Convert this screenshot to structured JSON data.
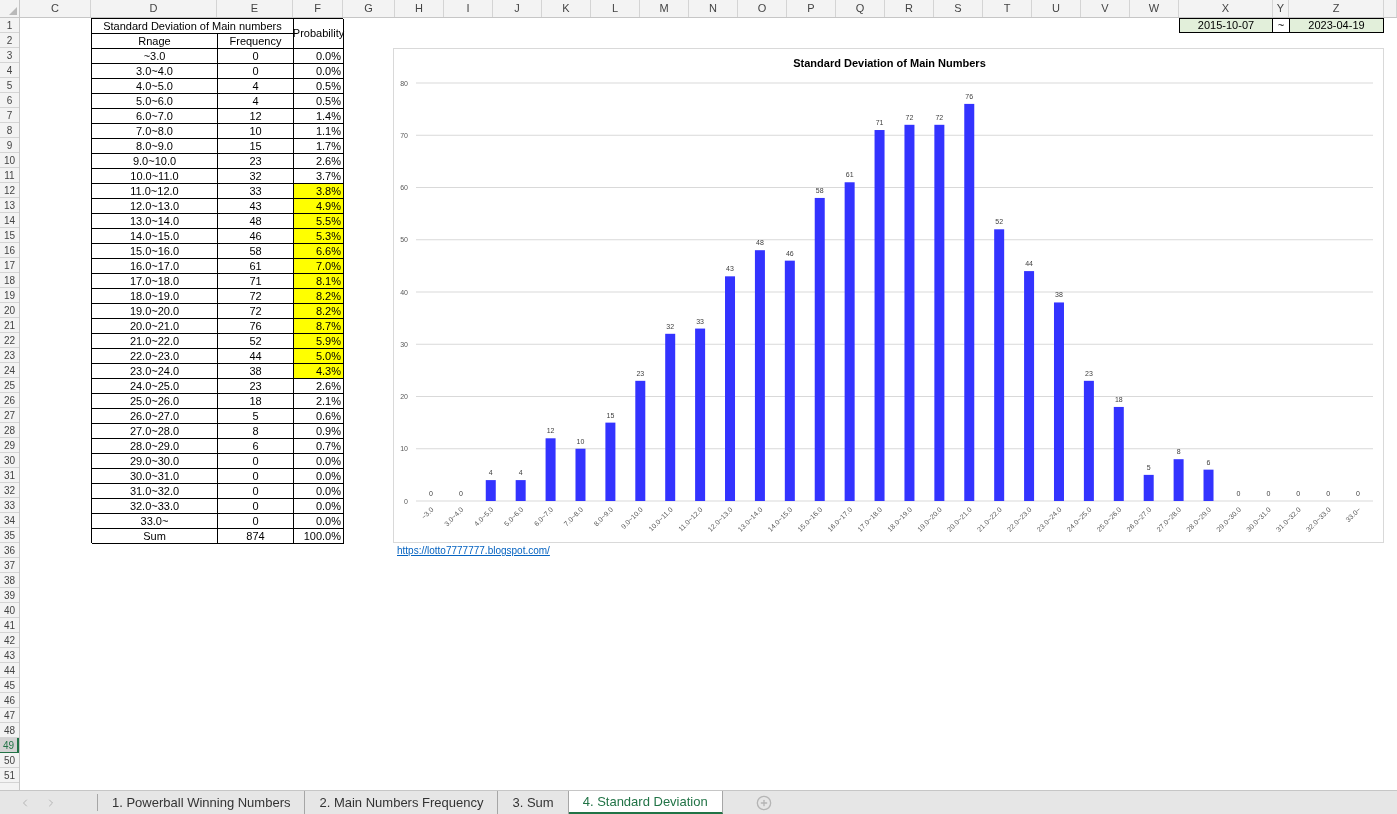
{
  "sheet": {
    "column_headers": [
      "C",
      "D",
      "E",
      "F",
      "G",
      "H",
      "I",
      "J",
      "K",
      "L",
      "M",
      "N",
      "O",
      "P",
      "Q",
      "R",
      "S",
      "T",
      "U",
      "V",
      "W",
      "X",
      "Y",
      "Z"
    ],
    "row_headers": [
      {
        "label": "1",
        "selected": false
      },
      {
        "label": "2",
        "selected": false
      },
      {
        "label": "3",
        "selected": false
      },
      {
        "label": "4",
        "selected": false
      },
      {
        "label": "5",
        "selected": false
      },
      {
        "label": "6",
        "selected": false
      },
      {
        "label": "7",
        "selected": false
      },
      {
        "label": "8",
        "selected": false
      },
      {
        "label": "9",
        "selected": false
      },
      {
        "label": "10",
        "selected": false
      },
      {
        "label": "11",
        "selected": false
      },
      {
        "label": "12",
        "selected": false
      },
      {
        "label": "13",
        "selected": false
      },
      {
        "label": "14",
        "selected": false
      },
      {
        "label": "15",
        "selected": false
      },
      {
        "label": "16",
        "selected": false
      },
      {
        "label": "17",
        "selected": false
      },
      {
        "label": "18",
        "selected": false
      },
      {
        "label": "19",
        "selected": false
      },
      {
        "label": "20",
        "selected": false
      },
      {
        "label": "21",
        "selected": false
      },
      {
        "label": "22",
        "selected": false
      },
      {
        "label": "23",
        "selected": false
      },
      {
        "label": "24",
        "selected": false
      },
      {
        "label": "25",
        "selected": false
      },
      {
        "label": "26",
        "selected": false
      },
      {
        "label": "27",
        "selected": false
      },
      {
        "label": "28",
        "selected": false
      },
      {
        "label": "29",
        "selected": false
      },
      {
        "label": "30",
        "selected": false
      },
      {
        "label": "31",
        "selected": false
      },
      {
        "label": "32",
        "selected": false
      },
      {
        "label": "33",
        "selected": false
      },
      {
        "label": "34",
        "selected": false
      },
      {
        "label": "35",
        "selected": false
      },
      {
        "label": "36",
        "selected": false
      },
      {
        "label": "37",
        "selected": false
      },
      {
        "label": "38",
        "selected": false
      },
      {
        "label": "39",
        "selected": false
      },
      {
        "label": "40",
        "selected": false
      },
      {
        "label": "41",
        "selected": false
      },
      {
        "label": "42",
        "selected": false
      },
      {
        "label": "43",
        "selected": false
      },
      {
        "label": "44",
        "selected": false
      },
      {
        "label": "45",
        "selected": false
      },
      {
        "label": "46",
        "selected": false
      },
      {
        "label": "47",
        "selected": false
      },
      {
        "label": "48",
        "selected": false
      },
      {
        "label": "49",
        "selected": true
      },
      {
        "label": "50",
        "selected": false
      },
      {
        "label": "51",
        "selected": false
      }
    ]
  },
  "table": {
    "title": "Standard Deviation of Main numbers",
    "columns": [
      "Rnage",
      "Frequency",
      "Probability"
    ],
    "rows": [
      {
        "range": "~3.0",
        "frequency": "0",
        "probability": "0.0%",
        "highlighted": false
      },
      {
        "range": "3.0~4.0",
        "frequency": "0",
        "probability": "0.0%",
        "highlighted": false
      },
      {
        "range": "4.0~5.0",
        "frequency": "4",
        "probability": "0.5%",
        "highlighted": false
      },
      {
        "range": "5.0~6.0",
        "frequency": "4",
        "probability": "0.5%",
        "highlighted": false
      },
      {
        "range": "6.0~7.0",
        "frequency": "12",
        "probability": "1.4%",
        "highlighted": false
      },
      {
        "range": "7.0~8.0",
        "frequency": "10",
        "probability": "1.1%",
        "highlighted": false
      },
      {
        "range": "8.0~9.0",
        "frequency": "15",
        "probability": "1.7%",
        "highlighted": false
      },
      {
        "range": "9.0~10.0",
        "frequency": "23",
        "probability": "2.6%",
        "highlighted": false
      },
      {
        "range": "10.0~11.0",
        "frequency": "32",
        "probability": "3.7%",
        "highlighted": false
      },
      {
        "range": "11.0~12.0",
        "frequency": "33",
        "probability": "3.8%",
        "highlighted": true
      },
      {
        "range": "12.0~13.0",
        "frequency": "43",
        "probability": "4.9%",
        "highlighted": true
      },
      {
        "range": "13.0~14.0",
        "frequency": "48",
        "probability": "5.5%",
        "highlighted": true
      },
      {
        "range": "14.0~15.0",
        "frequency": "46",
        "probability": "5.3%",
        "highlighted": true
      },
      {
        "range": "15.0~16.0",
        "frequency": "58",
        "probability": "6.6%",
        "highlighted": true
      },
      {
        "range": "16.0~17.0",
        "frequency": "61",
        "probability": "7.0%",
        "highlighted": true
      },
      {
        "range": "17.0~18.0",
        "frequency": "71",
        "probability": "8.1%",
        "highlighted": true
      },
      {
        "range": "18.0~19.0",
        "frequency": "72",
        "probability": "8.2%",
        "highlighted": true
      },
      {
        "range": "19.0~20.0",
        "frequency": "72",
        "probability": "8.2%",
        "highlighted": true
      },
      {
        "range": "20.0~21.0",
        "frequency": "76",
        "probability": "8.7%",
        "highlighted": true
      },
      {
        "range": "21.0~22.0",
        "frequency": "52",
        "probability": "5.9%",
        "highlighted": true
      },
      {
        "range": "22.0~23.0",
        "frequency": "44",
        "probability": "5.0%",
        "highlighted": true
      },
      {
        "range": "23.0~24.0",
        "frequency": "38",
        "probability": "4.3%",
        "highlighted": true
      },
      {
        "range": "24.0~25.0",
        "frequency": "23",
        "probability": "2.6%",
        "highlighted": false
      },
      {
        "range": "25.0~26.0",
        "frequency": "18",
        "probability": "2.1%",
        "highlighted": false
      },
      {
        "range": "26.0~27.0",
        "frequency": "5",
        "probability": "0.6%",
        "highlighted": false
      },
      {
        "range": "27.0~28.0",
        "frequency": "8",
        "probability": "0.9%",
        "highlighted": false
      },
      {
        "range": "28.0~29.0",
        "frequency": "6",
        "probability": "0.7%",
        "highlighted": false
      },
      {
        "range": "29.0~30.0",
        "frequency": "0",
        "probability": "0.0%",
        "highlighted": false
      },
      {
        "range": "30.0~31.0",
        "frequency": "0",
        "probability": "0.0%",
        "highlighted": false
      },
      {
        "range": "31.0~32.0",
        "frequency": "0",
        "probability": "0.0%",
        "highlighted": false
      },
      {
        "range": "32.0~33.0",
        "frequency": "0",
        "probability": "0.0%",
        "highlighted": false
      },
      {
        "range": "33.0~",
        "frequency": "0",
        "probability": "0.0%",
        "highlighted": false
      }
    ],
    "sum": {
      "label": "Sum",
      "frequency": "874",
      "probability": "100.0%"
    }
  },
  "date_range": {
    "start": "2015-10-07",
    "separator": "~",
    "end": "2023-04-19"
  },
  "chart": {
    "chart_data": {
      "type": "bar",
      "title": "Standard Deviation of Main Numbers",
      "categories": [
        "~3.0",
        "3.0~4.0",
        "4.0~5.0",
        "5.0~6.0",
        "6.0~7.0",
        "7.0~8.0",
        "8.0~9.0",
        "9.0~10.0",
        "10.0~11.0",
        "11.0~12.0",
        "12.0~13.0",
        "13.0~14.0",
        "14.0~15.0",
        "15.0~16.0",
        "16.0~17.0",
        "17.0~18.0",
        "18.0~19.0",
        "19.0~20.0",
        "20.0~21.0",
        "21.0~22.0",
        "22.0~23.0",
        "23.0~24.0",
        "24.0~25.0",
        "25.0~26.0",
        "26.0~27.0",
        "27.0~28.0",
        "28.0~29.0",
        "29.0~30.0",
        "30.0~31.0",
        "31.0~32.0",
        "32.0~33.0",
        "33.0~"
      ],
      "series": [
        {
          "color": "#3333ff",
          "values": [
            0,
            0,
            4,
            4,
            12,
            10,
            15,
            23,
            32,
            33,
            43,
            48,
            46,
            58,
            61,
            71,
            72,
            72,
            76,
            52,
            44,
            38,
            23,
            18,
            5,
            8,
            6,
            0,
            0,
            0,
            0,
            0
          ]
        }
      ],
      "ylim": [
        0,
        80
      ],
      "yticks": [
        0,
        10,
        20,
        30,
        40,
        50,
        60,
        70,
        80
      ],
      "data_labels": true,
      "grid": true
    }
  },
  "link": "https://lotto7777777.blogspot.com/",
  "sheet_tabs": [
    {
      "label": "1. Powerball Winning Numbers",
      "selected": false
    },
    {
      "label": "2. Main Numbers Frequency",
      "selected": false
    },
    {
      "label": "3. Sum",
      "selected": false
    },
    {
      "label": "4. Standard Deviation",
      "selected": true
    }
  ]
}
